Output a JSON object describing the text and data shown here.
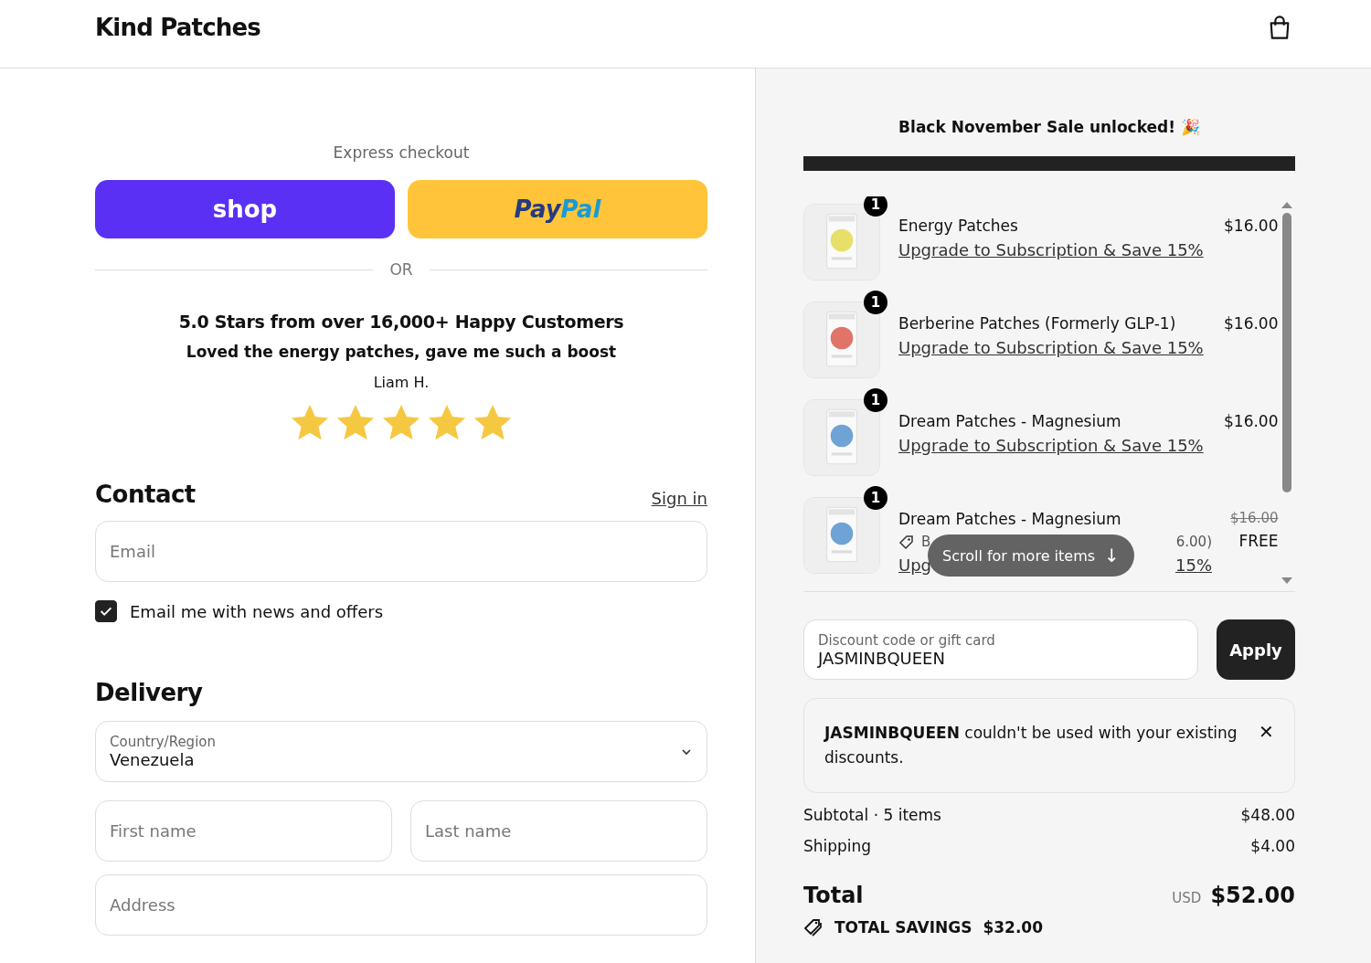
{
  "header": {
    "brand": "Kind Patches"
  },
  "express": {
    "title": "Express checkout",
    "buttons": [
      {
        "kind": "shop",
        "label": "shop"
      },
      {
        "kind": "paypal",
        "label": "PayPal"
      }
    ],
    "divider": "OR"
  },
  "review": {
    "headline": "5.0 Stars from over 16,000+ Happy Customers",
    "quote": "Loved the energy patches, gave me such a boost",
    "author": "Liam H.",
    "stars": 5
  },
  "contact": {
    "title": "Contact",
    "sign_in": "Sign in",
    "email": {
      "placeholder": "Email"
    },
    "newsletter": {
      "label": "Email me with news and offers",
      "checked": true
    }
  },
  "delivery": {
    "title": "Delivery",
    "country": {
      "label": "Country/Region",
      "value": "Venezuela"
    },
    "first_name": {
      "placeholder": "First name"
    },
    "last_name": {
      "placeholder": "Last name"
    },
    "address": {
      "placeholder": "Address"
    }
  },
  "summary": {
    "banner": "Black November Sale unlocked! 🎉",
    "progress": {
      "level": 1
    },
    "items": [
      {
        "name": "Energy Patches",
        "quantity": "1",
        "price": "$16.00",
        "link": "Upgrade to Subscription & Save 15%",
        "color": "#e6e06a"
      },
      {
        "name": "Berberine Patches (Formerly GLP-1)",
        "quantity": "1",
        "price": "$16.00",
        "link": "Upgrade to Subscription & Save 15%",
        "color": "#e07468"
      },
      {
        "name": "Dream Patches - Magnesium",
        "quantity": "1",
        "price": "$16.00",
        "link": "Upgrade to Subscription & Save 15%",
        "color": "#6fa3d6"
      },
      {
        "name": "Dream Patches - Magnesium",
        "quantity": "1",
        "old_price": "$16.00",
        "price": "FREE",
        "discount_parts": [
          "B",
          "6.00)"
        ],
        "link_parts": [
          "Upg",
          "15%"
        ],
        "color": "#6fa3d6"
      }
    ],
    "scroll_hint": "Scroll for more items",
    "scroll_hint_icon": "↓",
    "discount": {
      "label": "Discount code or gift card",
      "value": "JASMINBQUEEN",
      "button": "Apply"
    },
    "error": {
      "message": "**JASMINBQUEEN** couldn't be used with your existing discounts.",
      "close": "✕"
    },
    "lines": [
      {
        "label": "Subtotal · 5 items",
        "value": "$48.00"
      },
      {
        "label": "Shipping",
        "value": "$4.00"
      }
    ],
    "total": {
      "label": "Total",
      "currency": "USD",
      "value": "$52.00"
    },
    "savings": {
      "label": "TOTAL SAVINGS",
      "value": "$32.00"
    }
  }
}
